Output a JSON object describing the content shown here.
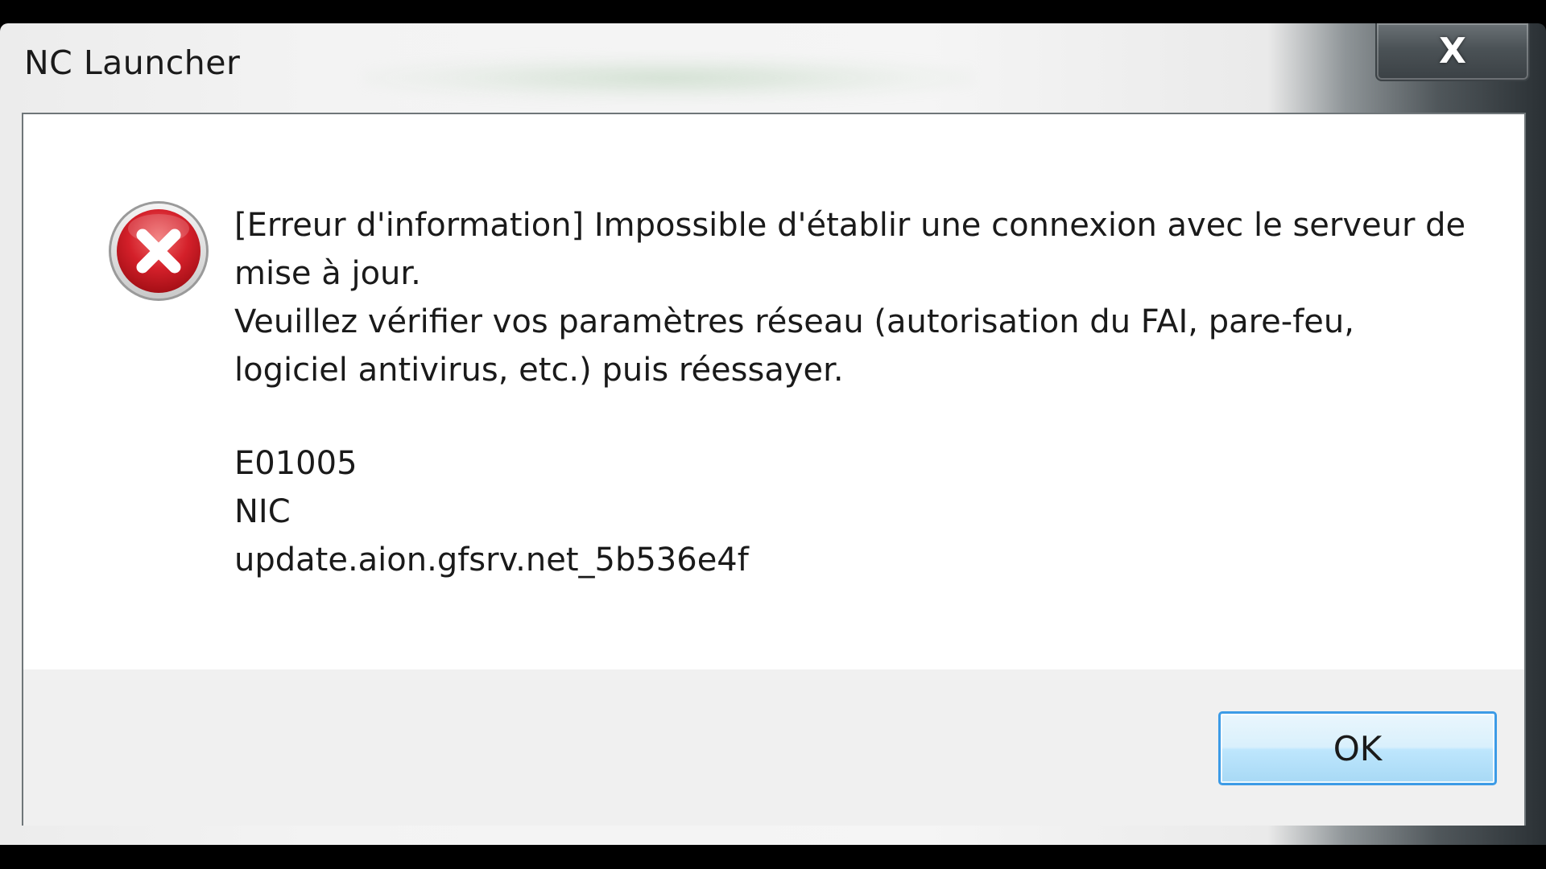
{
  "window": {
    "title": "NC Launcher",
    "close_label": "X"
  },
  "dialog": {
    "icon": "error-icon",
    "message_line1": "[Erreur d'information] Impossible d'établir une connexion avec le serveur de mise à jour.",
    "message_line2": "Veuillez vérifier vos paramètres réseau (autorisation du FAI, pare-feu, logiciel antivirus, etc.) puis réessayer.",
    "error_code": "E01005",
    "nic_label": "NIC",
    "server": "update.aion.gfsrv.net_5b536e4f",
    "ok_label": "OK"
  },
  "colors": {
    "error_red": "#c8151b",
    "button_border": "#3c9be6",
    "footer_bg": "#f0f0f0"
  }
}
